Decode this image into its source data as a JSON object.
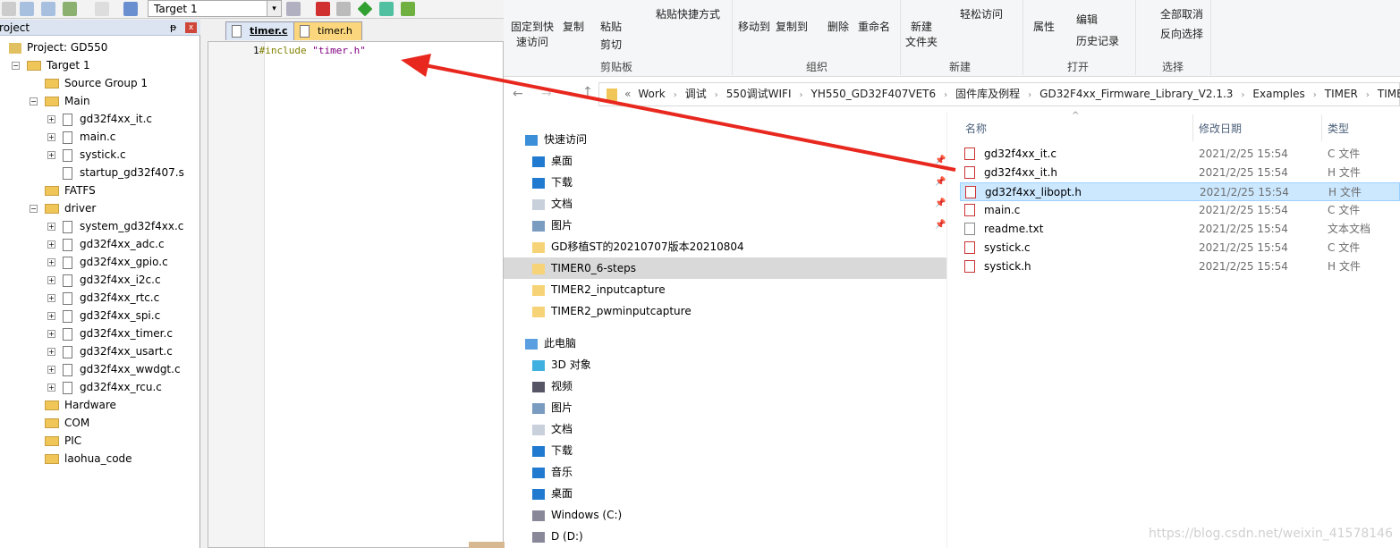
{
  "keil": {
    "target_select": "Target 1",
    "project_panel_title": "Project",
    "tree": [
      {
        "label": "Project: GD550",
        "level": 0,
        "kind": "project"
      },
      {
        "label": "Target 1",
        "level": 1,
        "kind": "target",
        "expanded": true
      },
      {
        "label": "Source Group 1",
        "level": 2,
        "kind": "folder"
      },
      {
        "label": "Main",
        "level": 2,
        "kind": "folder",
        "expanded": true
      },
      {
        "label": "gd32f4xx_it.c",
        "level": 3,
        "kind": "file",
        "plus": true
      },
      {
        "label": "main.c",
        "level": 3,
        "kind": "file",
        "plus": true
      },
      {
        "label": "systick.c",
        "level": 3,
        "kind": "file",
        "plus": true
      },
      {
        "label": "startup_gd32f407.s",
        "level": 3,
        "kind": "file"
      },
      {
        "label": "FATFS",
        "level": 2,
        "kind": "folder"
      },
      {
        "label": "driver",
        "level": 2,
        "kind": "folder",
        "expanded": true
      },
      {
        "label": "system_gd32f4xx.c",
        "level": 3,
        "kind": "file",
        "plus": true
      },
      {
        "label": "gd32f4xx_adc.c",
        "level": 3,
        "kind": "file",
        "plus": true
      },
      {
        "label": "gd32f4xx_gpio.c",
        "level": 3,
        "kind": "file",
        "plus": true
      },
      {
        "label": "gd32f4xx_i2c.c",
        "level": 3,
        "kind": "file",
        "plus": true
      },
      {
        "label": "gd32f4xx_rtc.c",
        "level": 3,
        "kind": "file",
        "plus": true
      },
      {
        "label": "gd32f4xx_spi.c",
        "level": 3,
        "kind": "file",
        "plus": true
      },
      {
        "label": "gd32f4xx_timer.c",
        "level": 3,
        "kind": "file",
        "plus": true
      },
      {
        "label": "gd32f4xx_usart.c",
        "level": 3,
        "kind": "file",
        "plus": true
      },
      {
        "label": "gd32f4xx_wwdgt.c",
        "level": 3,
        "kind": "file",
        "plus": true
      },
      {
        "label": "gd32f4xx_rcu.c",
        "level": 3,
        "kind": "file",
        "plus": true
      },
      {
        "label": "Hardware",
        "level": 2,
        "kind": "folder"
      },
      {
        "label": "COM",
        "level": 2,
        "kind": "folder"
      },
      {
        "label": "PIC",
        "level": 2,
        "kind": "folder"
      },
      {
        "label": "laohua_code",
        "level": 2,
        "kind": "folder"
      }
    ],
    "tabs": [
      {
        "label": "timer.c",
        "active": true
      },
      {
        "label": "timer.h",
        "active": false
      }
    ],
    "code": {
      "line_no": "1",
      "directive": "#include",
      "string": "\"timer.h\""
    }
  },
  "explorer": {
    "ribbon": {
      "buttons": [
        "固定到快\n速访问",
        "复制",
        "粘贴",
        "粘贴快捷方式",
        "剪切",
        "移动到",
        "复制到",
        "删除",
        "重命名",
        "新建\n文件夹",
        "轻松访问",
        "属性",
        "编辑",
        "历史记录",
        "全部取消",
        "反向选择"
      ],
      "groups": [
        "剪贴板",
        "组织",
        "新建",
        "打开",
        "选择"
      ]
    },
    "breadcrumb": [
      "Work",
      "调试",
      "550调试WIFI",
      "YH550_GD32F407VET6",
      "固件库及例程",
      "GD32F4xx_Firmware_Library_V2.1.3",
      "Examples",
      "TIMER",
      "TIMER"
    ],
    "nav": [
      {
        "label": "快速访问",
        "level": 0,
        "icon": "star-icon"
      },
      {
        "label": "桌面",
        "level": 1,
        "icon": "desktop-icon",
        "pin": true
      },
      {
        "label": "下载",
        "level": 1,
        "icon": "download-icon",
        "pin": true
      },
      {
        "label": "文档",
        "level": 1,
        "icon": "document-icon",
        "pin": true
      },
      {
        "label": "图片",
        "level": 1,
        "icon": "picture-icon",
        "pin": true
      },
      {
        "label": "GD移植ST的20210707版本20210804",
        "level": 1,
        "icon": "folder-icon"
      },
      {
        "label": "TIMER0_6-steps",
        "level": 1,
        "icon": "folder-icon",
        "selected": true
      },
      {
        "label": "TIMER2_inputcapture",
        "level": 1,
        "icon": "folder-icon"
      },
      {
        "label": "TIMER2_pwminputcapture",
        "level": 1,
        "icon": "folder-icon"
      },
      {
        "label": "此电脑",
        "level": 0,
        "icon": "computer-icon"
      },
      {
        "label": "3D 对象",
        "level": 1,
        "icon": "cube-icon"
      },
      {
        "label": "视频",
        "level": 1,
        "icon": "video-icon"
      },
      {
        "label": "图片",
        "level": 1,
        "icon": "picture-icon"
      },
      {
        "label": "文档",
        "level": 1,
        "icon": "document-icon"
      },
      {
        "label": "下载",
        "level": 1,
        "icon": "download-icon"
      },
      {
        "label": "音乐",
        "level": 1,
        "icon": "music-icon"
      },
      {
        "label": "桌面",
        "level": 1,
        "icon": "desktop-icon"
      },
      {
        "label": "Windows (C:)",
        "level": 1,
        "icon": "drive-icon"
      },
      {
        "label": "D (D:)",
        "level": 1,
        "icon": "drive-icon"
      }
    ],
    "columns": [
      "名称",
      "修改日期",
      "类型"
    ],
    "files": [
      {
        "name": "gd32f4xx_it.c",
        "date": "2021/2/25 15:54",
        "type": "C 文件"
      },
      {
        "name": "gd32f4xx_it.h",
        "date": "2021/2/25 15:54",
        "type": "H 文件"
      },
      {
        "name": "gd32f4xx_libopt.h",
        "date": "2021/2/25 15:54",
        "type": "H 文件",
        "selected": true
      },
      {
        "name": "main.c",
        "date": "2021/2/25 15:54",
        "type": "C 文件"
      },
      {
        "name": "readme.txt",
        "date": "2021/2/25 15:54",
        "type": "文本文档"
      },
      {
        "name": "systick.c",
        "date": "2021/2/25 15:54",
        "type": "C 文件"
      },
      {
        "name": "systick.h",
        "date": "2021/2/25 15:54",
        "type": "H 文件"
      }
    ]
  },
  "watermark": "https://blog.csdn.net/weixin_41578146",
  "colors": {
    "arrow": "#e8281e",
    "selection": "#cce8ff",
    "nav_selected": "#d9d9d9",
    "code_string": "#800080",
    "code_directive": "#808000"
  }
}
